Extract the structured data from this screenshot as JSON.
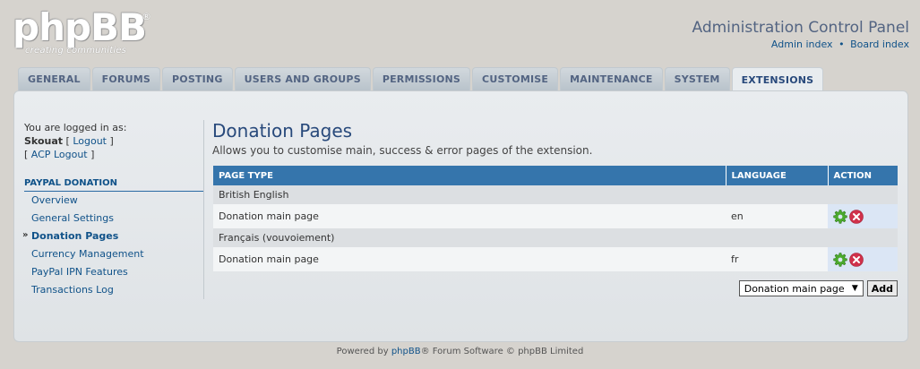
{
  "header": {
    "logo_text": "phpBB",
    "logo_reg": "®",
    "logo_tagline": "creating  communities",
    "title": "Administration Control Panel",
    "links": [
      "Admin index",
      "Board index"
    ],
    "link_separator": "•"
  },
  "tabs": [
    {
      "label": "GENERAL",
      "active": false
    },
    {
      "label": "FORUMS",
      "active": false
    },
    {
      "label": "POSTING",
      "active": false
    },
    {
      "label": "USERS AND GROUPS",
      "active": false
    },
    {
      "label": "PERMISSIONS",
      "active": false
    },
    {
      "label": "CUSTOMISE",
      "active": false
    },
    {
      "label": "MAINTENANCE",
      "active": false
    },
    {
      "label": "SYSTEM",
      "active": false
    },
    {
      "label": "EXTENSIONS",
      "active": true
    }
  ],
  "sidebar": {
    "logged_in_text": "You are logged in as:",
    "username": "Skouat",
    "logout_label": "Logout",
    "acp_logout_label": "ACP Logout",
    "menu_heading": "PAYPAL DONATION",
    "items": [
      {
        "label": "Overview",
        "active": false
      },
      {
        "label": "General Settings",
        "active": false
      },
      {
        "label": "Donation Pages",
        "active": true
      },
      {
        "label": "Currency Management",
        "active": false
      },
      {
        "label": "PayPal IPN Features",
        "active": false
      },
      {
        "label": "Transactions Log",
        "active": false
      }
    ]
  },
  "main": {
    "title": "Donation Pages",
    "description": "Allows you to customise main, success & error pages of the extension.",
    "table": {
      "headers": [
        "PAGE TYPE",
        "LANGUAGE",
        "ACTION"
      ],
      "groups": [
        {
          "language_name": "British English",
          "rows": [
            {
              "page_type": "Donation main page",
              "language": "en"
            }
          ]
        },
        {
          "language_name": "Français (vouvoiement)",
          "rows": [
            {
              "page_type": "Donation main page",
              "language": "fr"
            }
          ]
        }
      ]
    },
    "select_value": "Donation main page",
    "add_label": "Add"
  },
  "footer": {
    "prefix": "Powered by ",
    "brand": "phpBB",
    "suffix": "® Forum Software © phpBB Limited"
  },
  "colors": {
    "background": "#d6d3ce",
    "accent": "#105289",
    "table_header": "#3575ac",
    "edit_icon": "#4caa2e",
    "delete_icon": "#d0314b"
  }
}
